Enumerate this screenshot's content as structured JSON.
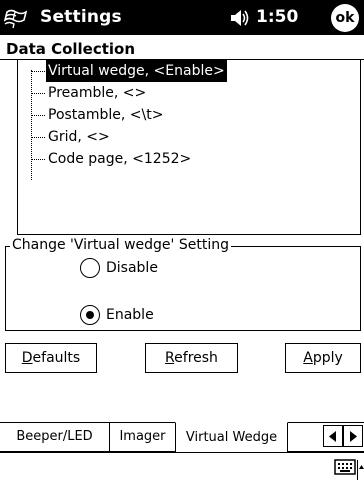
{
  "titlebar": {
    "title": "Settings",
    "clock": "1:50",
    "ok_label": "ok",
    "start_icon": "windows-flag-icon",
    "volume_icon": "speaker-icon"
  },
  "page": {
    "header": "Data Collection"
  },
  "tree": {
    "items": [
      {
        "label": "Virtual wedge, <Enable>",
        "selected": true
      },
      {
        "label": "Preamble, <>",
        "selected": false
      },
      {
        "label": "Postamble, <\\t>",
        "selected": false
      },
      {
        "label": "Grid, <>",
        "selected": false
      },
      {
        "label": "Code page, <1252>",
        "selected": false
      }
    ]
  },
  "setting_group": {
    "legend": "Change 'Virtual wedge' Setting",
    "options": [
      {
        "label": "Disable",
        "checked": false
      },
      {
        "label": "Enable",
        "checked": true
      }
    ]
  },
  "buttons": {
    "defaults": {
      "mnemonic": "D",
      "rest": "efaults"
    },
    "refresh": {
      "mnemonic": "R",
      "rest": "efresh"
    },
    "apply": {
      "mnemonic": "A",
      "rest": "pply"
    }
  },
  "tabs": [
    {
      "label": "Beeper/LED",
      "active": false
    },
    {
      "label": "Imager",
      "active": false
    },
    {
      "label": "Virtual Wedge",
      "active": true
    }
  ],
  "menubar": {
    "keyboard_icon": "keyboard-icon",
    "arrow_icon": "up-arrow-icon"
  }
}
